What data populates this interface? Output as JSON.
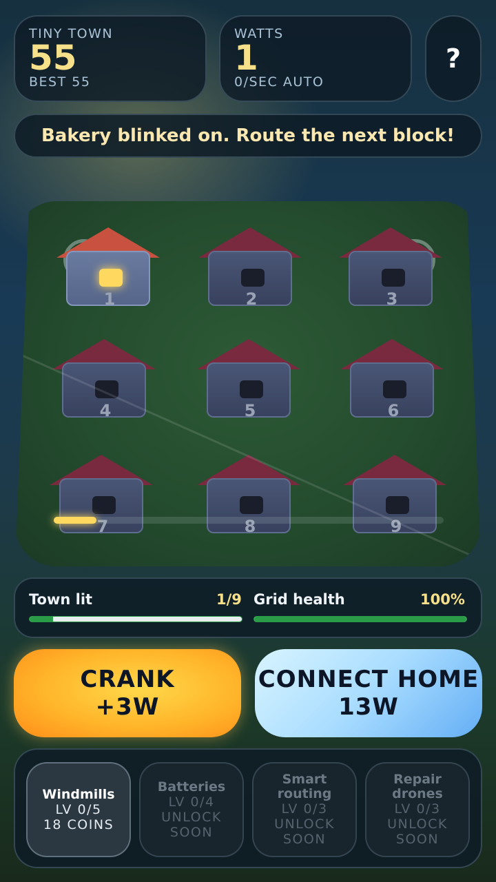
{
  "stats": {
    "town": {
      "label": "TINY TOWN",
      "value": "55",
      "sub": "BEST 55"
    },
    "watts": {
      "label": "WATTS",
      "value": "1",
      "sub": "0/SEC AUTO"
    },
    "help_label": "?"
  },
  "message": "Bakery blinked on. Route the next block!",
  "houses": [
    {
      "num": "1",
      "lit": true
    },
    {
      "num": "2",
      "lit": false
    },
    {
      "num": "3",
      "lit": false
    },
    {
      "num": "4",
      "lit": false
    },
    {
      "num": "5",
      "lit": false
    },
    {
      "num": "6",
      "lit": false
    },
    {
      "num": "7",
      "lit": false
    },
    {
      "num": "8",
      "lit": false
    },
    {
      "num": "9",
      "lit": false
    }
  ],
  "connection_progress": 0.11,
  "meters": {
    "town_lit": {
      "label": "Town lit",
      "value": "1/9",
      "fraction": 0.111
    },
    "grid_health": {
      "label": "Grid health",
      "value": "100%",
      "fraction": 1.0
    }
  },
  "actions": {
    "crank": {
      "line1": "CRANK",
      "line2": "+3W"
    },
    "connect": {
      "line1": "CONNECT HOME",
      "line2": "13W"
    }
  },
  "upgrades": [
    {
      "name": "Windmills",
      "detail1": "LV 0/5",
      "detail2": "18 COINS",
      "active": true
    },
    {
      "name": "Batteries",
      "detail1": "LV 0/4",
      "detail2": "UNLOCK",
      "detail3": "SOON",
      "active": false
    },
    {
      "name": "Smart routing",
      "detail1": "LV 0/3",
      "detail2": "UNLOCK",
      "detail3": "SOON",
      "active": false
    },
    {
      "name": "Repair drones",
      "detail1": "LV 0/3",
      "detail2": "UNLOCK",
      "detail3": "SOON",
      "active": false
    }
  ],
  "colors": {
    "accent_yellow": "#f7e08a",
    "lit_window": "#ffd860",
    "health_green": "#2a9b46",
    "crank_orange": "#ffb52a",
    "connect_blue": "#a8dcff"
  }
}
